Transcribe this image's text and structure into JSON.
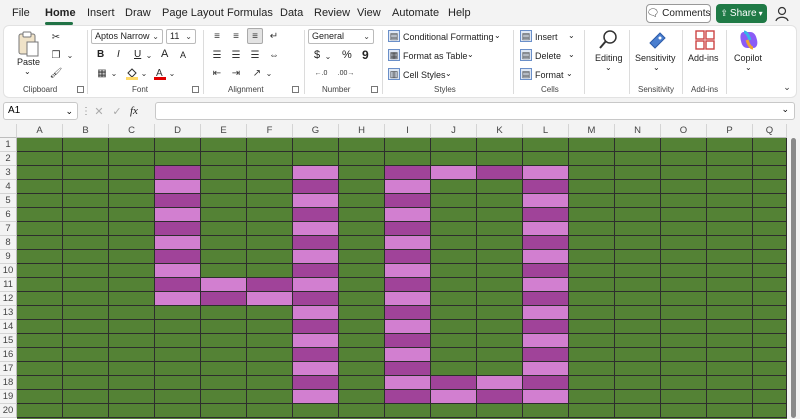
{
  "menu": {
    "items": [
      "File",
      "Home",
      "Insert",
      "Draw",
      "Page Layout",
      "Formulas",
      "Data",
      "Review",
      "View",
      "Automate",
      "Help"
    ],
    "active": "Home",
    "comments_label": "Comments",
    "share_label": "Share"
  },
  "ribbon": {
    "clipboard": {
      "paste_label": "Paste",
      "group_label": "Clipboard"
    },
    "font": {
      "font_name": "Aptos Narrow",
      "font_size": "11",
      "bold": "B",
      "italic": "I",
      "underline": "U",
      "grow": "A",
      "shrink": "A",
      "group_label": "Font"
    },
    "alignment": {
      "group_label": "Alignment"
    },
    "number": {
      "format": "General",
      "currency": "$",
      "percent": "%",
      "comma": "9",
      "group_label": "Number"
    },
    "styles": {
      "conditional_formatting": "Conditional Formatting",
      "format_as_table": "Format as Table",
      "cell_styles": "Cell Styles",
      "group_label": "Styles"
    },
    "cells": {
      "insert": "Insert",
      "delete": "Delete",
      "format": "Format",
      "group_label": "Cells"
    },
    "editing": {
      "label": "Editing"
    },
    "sensitivity": {
      "label": "Sensitivity",
      "group_label": "Sensitivity"
    },
    "addins": {
      "label": "Add-ins",
      "group_label": "Add-ins"
    },
    "copilot": {
      "label": "Copilot"
    }
  },
  "formula_bar": {
    "name_box": "A1",
    "fx": "fx",
    "value": ""
  },
  "sheet": {
    "columns": [
      "A",
      "B",
      "C",
      "D",
      "E",
      "F",
      "G",
      "H",
      "I",
      "J",
      "K",
      "L",
      "M",
      "N",
      "O",
      "P",
      "Q"
    ],
    "rows": [
      "1",
      "2",
      "3",
      "4",
      "5",
      "6",
      "7",
      "8",
      "9",
      "10",
      "11",
      "12",
      "13",
      "14",
      "15",
      "16",
      "17",
      "18",
      "19",
      "20"
    ]
  },
  "colors": {
    "background_fill": "#548235",
    "magenta_dark": "#a04399",
    "magenta_light": "#d27fd0",
    "accent": "#217346"
  }
}
